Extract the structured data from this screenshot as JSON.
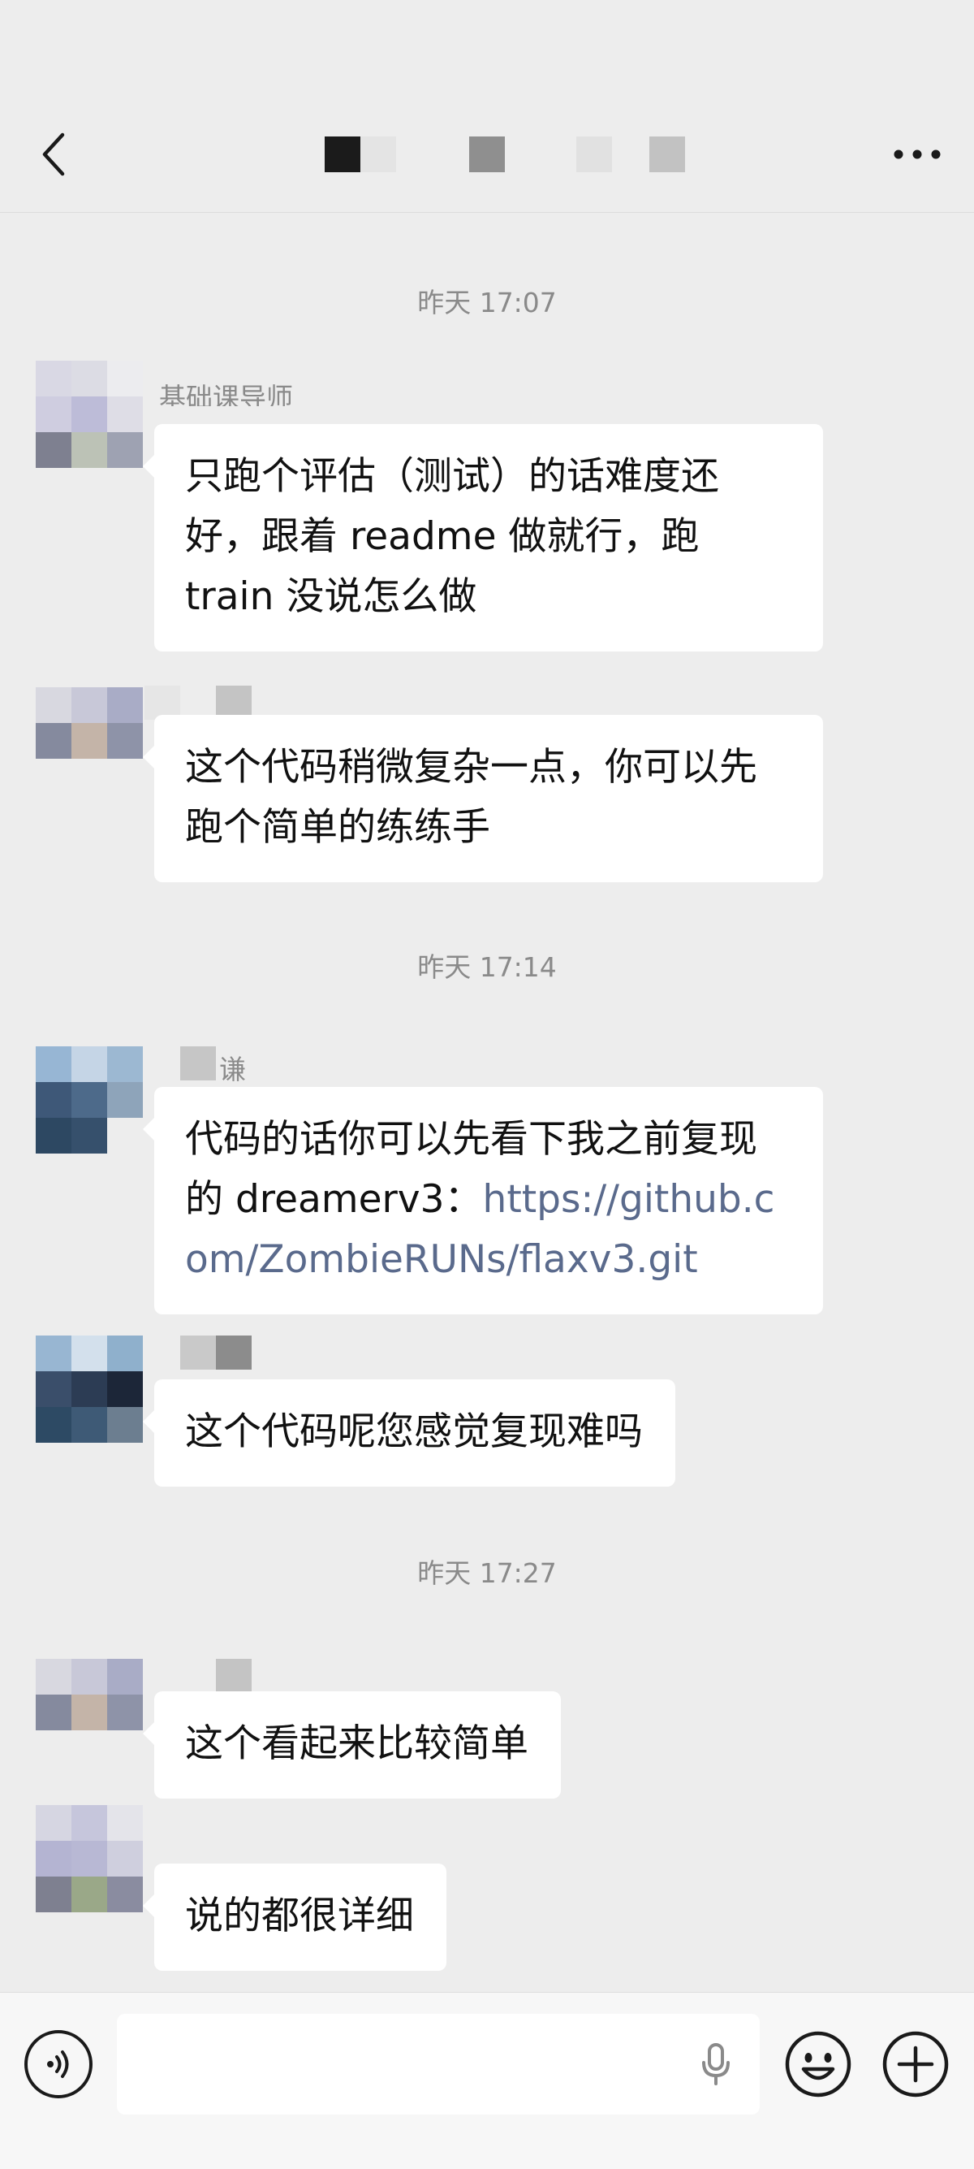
{
  "header": {
    "title": "",
    "back_icon": "chevron-left-icon",
    "more_icon": "more-dots-icon"
  },
  "messages": [
    {
      "type": "timestamp",
      "text": "昨天 17:07"
    },
    {
      "type": "message",
      "sender": "基础课导师",
      "text": "只跑个评估（测试）的话难度还好，跟着 readme 做就行，跑 train 没说怎么做"
    },
    {
      "type": "message",
      "sender": "",
      "text": "这个代码稍微复杂一点，你可以先跑个简单的练练手"
    },
    {
      "type": "timestamp",
      "text": "昨天 17:14"
    },
    {
      "type": "message",
      "sender": "谦",
      "text_prefix": "代码的话你可以先看下我之前复现的 dreamerv3：",
      "link": "https://github.com/ZombieRUNs/flaxv3.git"
    },
    {
      "type": "message",
      "sender": "",
      "text": "这个代码呢您感觉复现难吗"
    },
    {
      "type": "timestamp",
      "text": "昨天 17:27"
    },
    {
      "type": "message",
      "sender": "",
      "text": "这个看起来比较简单"
    },
    {
      "type": "message",
      "sender": "",
      "text": "说的都很详细"
    }
  ],
  "input_bar": {
    "placeholder": "",
    "voice_icon": "voice-wave-icon",
    "mic_icon": "microphone-icon",
    "emoji_icon": "smile-icon",
    "plus_icon": "plus-circle-icon"
  },
  "colors": {
    "background": "#ededed",
    "bubble": "#ffffff",
    "timestamp_text": "#8a8a8a",
    "link": "#5a6a8c",
    "input_bar": "#f7f7f7"
  }
}
